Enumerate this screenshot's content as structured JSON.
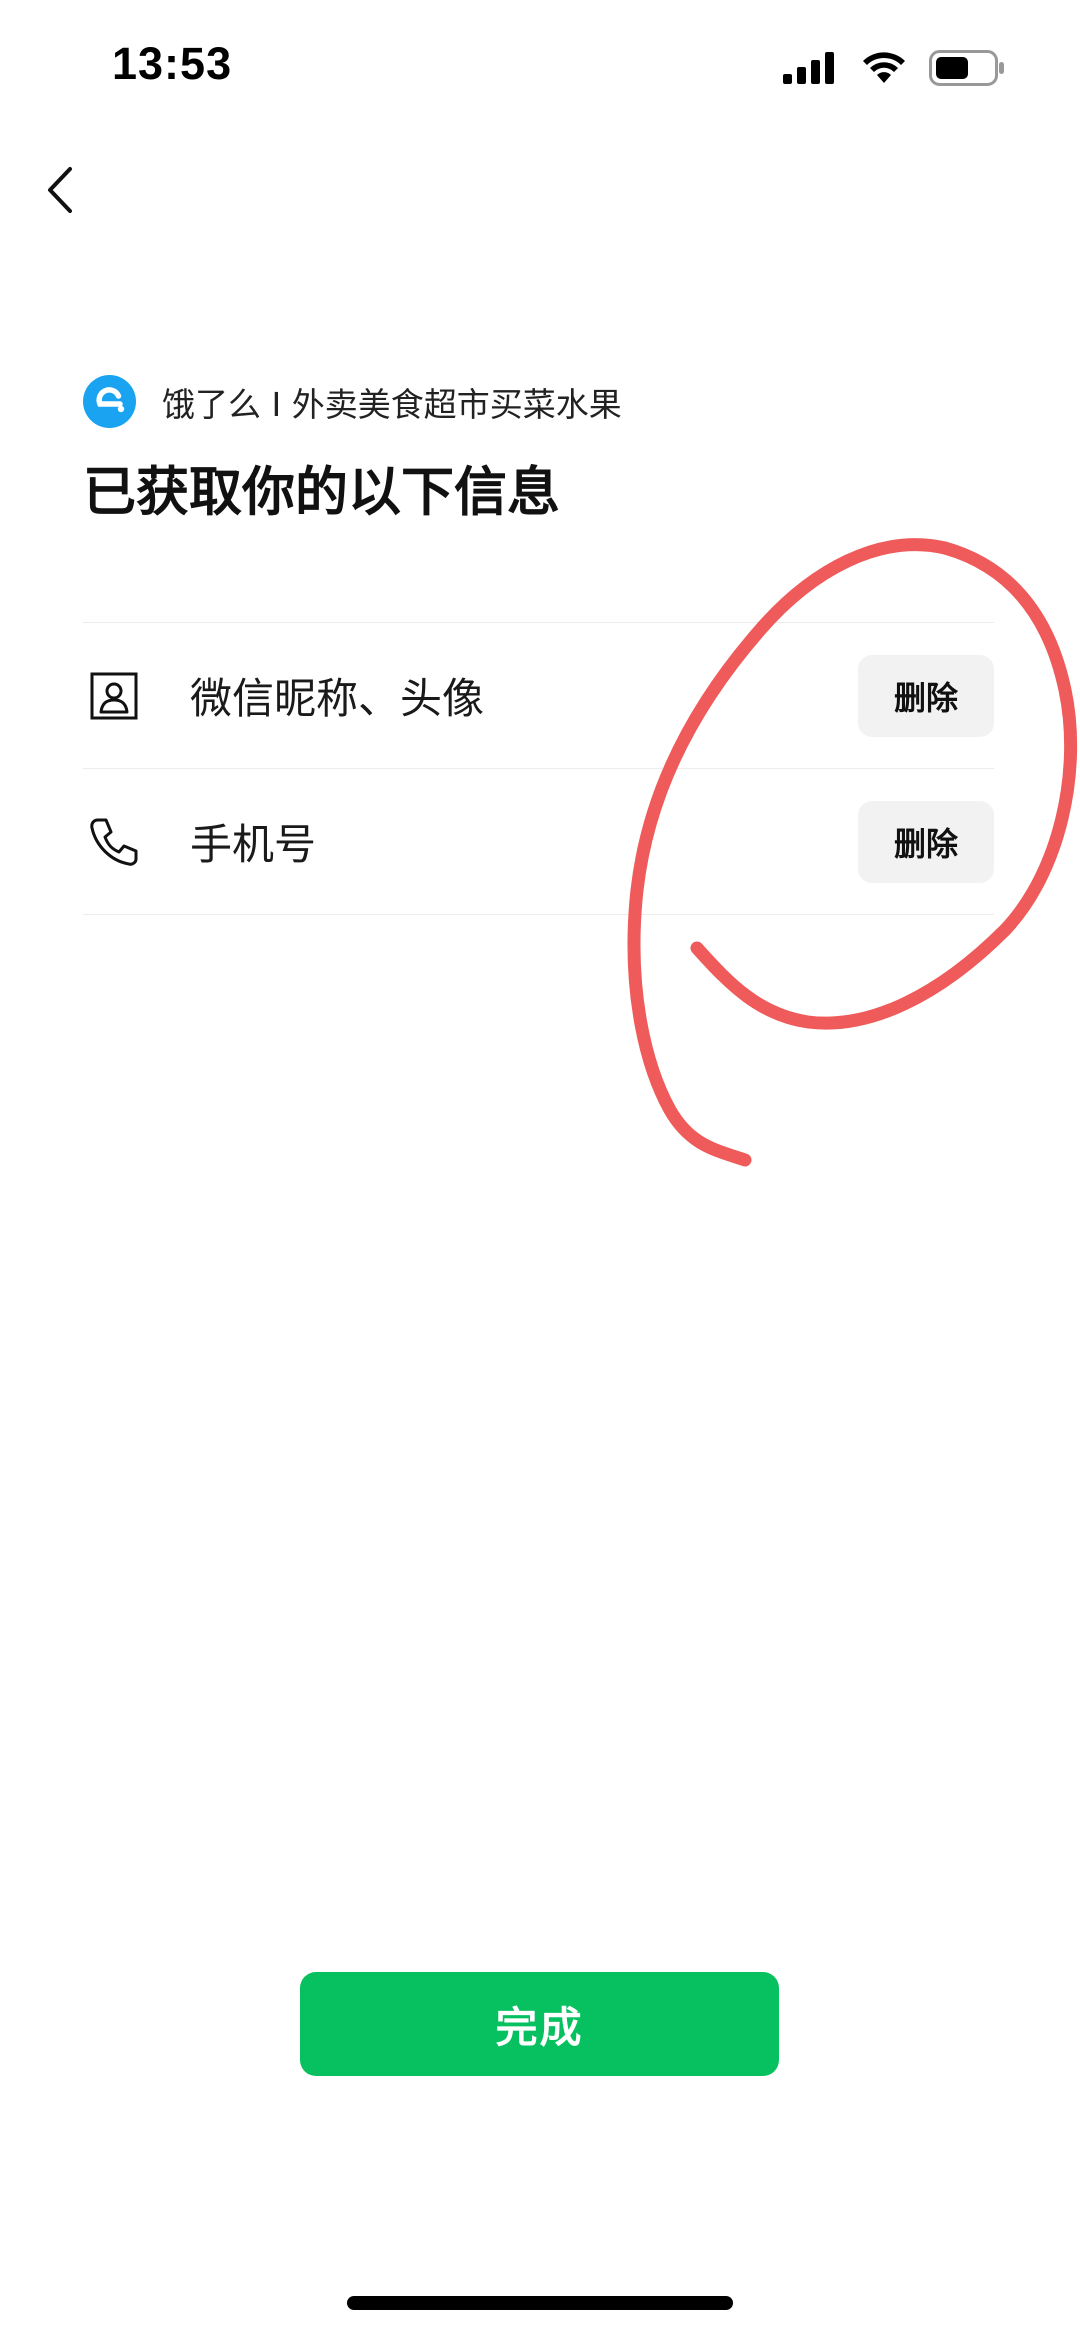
{
  "status_bar": {
    "time": "13:53",
    "icons": [
      "cellular-signal-icon",
      "wifi-icon",
      "battery-icon"
    ]
  },
  "nav": {
    "back_icon": "chevron-left-icon"
  },
  "header": {
    "app_name": "饿了么 I 外卖美食超市买菜水果",
    "app_logo": "eleme-logo-icon",
    "title": "已获取你的以下信息"
  },
  "info_items": [
    {
      "icon": "user-card-icon",
      "label": "微信昵称、头像",
      "action": "删除"
    },
    {
      "icon": "phone-icon",
      "label": "手机号",
      "action": "删除"
    }
  ],
  "footer": {
    "done_label": "完成"
  },
  "colors": {
    "primary_green": "#07c160",
    "logo_blue": "#1aa3f0",
    "annotation_red": "#ef5a5a"
  }
}
